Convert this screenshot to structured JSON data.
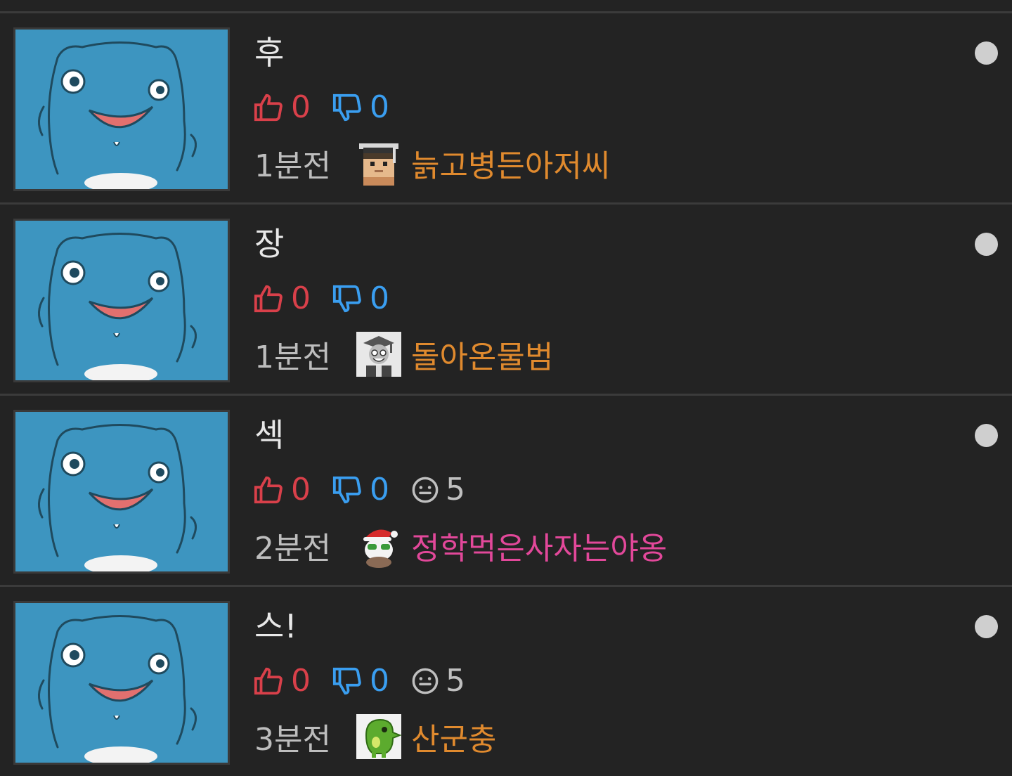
{
  "colors": {
    "background": "#232323",
    "divider": "#3b3b3b",
    "like": "#d9404a",
    "dislike": "#3a9ef0",
    "author_orange": "#e08a2e",
    "author_pink": "#e2489a",
    "unread_dot": "#cfcfcf"
  },
  "posts": [
    {
      "title": "후",
      "likes": "0",
      "dislikes": "0",
      "comments": "",
      "time": "1분전",
      "author": "늙고병든아저씨",
      "avatar_icon": "pixel-graduate-avatar-icon",
      "author_color": "orange"
    },
    {
      "title": "장",
      "likes": "0",
      "dislikes": "0",
      "comments": "",
      "time": "1분전",
      "author": "돌아온물범",
      "avatar_icon": "grayscale-graduate-avatar-icon",
      "author_color": "orange"
    },
    {
      "title": "섹",
      "likes": "0",
      "dislikes": "0",
      "comments": "5",
      "time": "2분전",
      "author": "정학먹은사자는야옹",
      "avatar_icon": "santa-hat-avatar-icon",
      "author_color": "pink"
    },
    {
      "title": "스!",
      "likes": "0",
      "dislikes": "0",
      "comments": "5",
      "time": "3분전",
      "author": "산군충",
      "avatar_icon": "green-creature-avatar-icon",
      "author_color": "orange"
    }
  ]
}
